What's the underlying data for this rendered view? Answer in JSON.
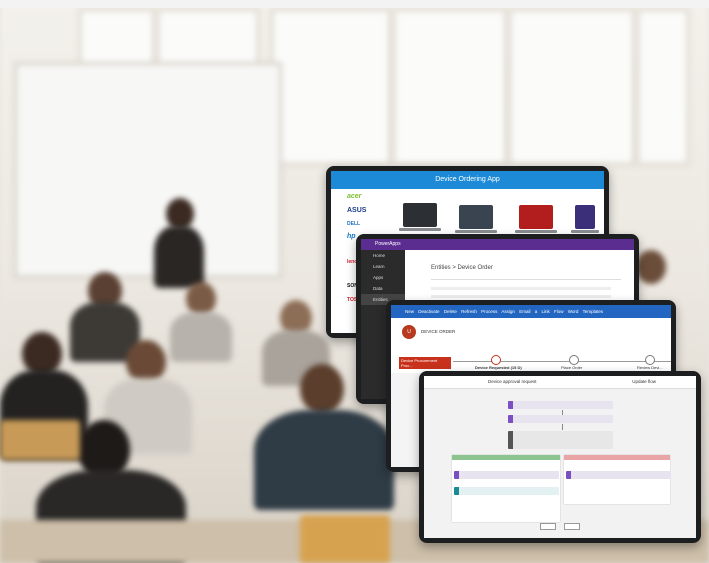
{
  "device_ordering_app": {
    "title": "Device Ordering App",
    "brands": [
      "acer",
      "ASUS",
      "DELL",
      "hp",
      "lenovo",
      "SONY",
      "TOSHIBA"
    ]
  },
  "powerapps": {
    "app_name": "PowerApps",
    "side_items": [
      "Home",
      "Learn",
      "Apps",
      "Data",
      "Entities"
    ],
    "crumb": "Entities > Device Order"
  },
  "dynamics": {
    "avatar": "U",
    "record": "DEVICE ORDER",
    "stage_active": "Device Procurement Proc...",
    "stages": [
      "Device Requested (15 D)",
      "Place Order",
      "Review Devi..."
    ],
    "toolbar": [
      "New",
      "Deactivate",
      "Delete",
      "Refresh",
      "Process",
      "Assign",
      "Email a Link",
      "Flow",
      "Word Templates"
    ]
  },
  "flow": {
    "header_title": "Device approval request",
    "header_right": "Update flow"
  }
}
